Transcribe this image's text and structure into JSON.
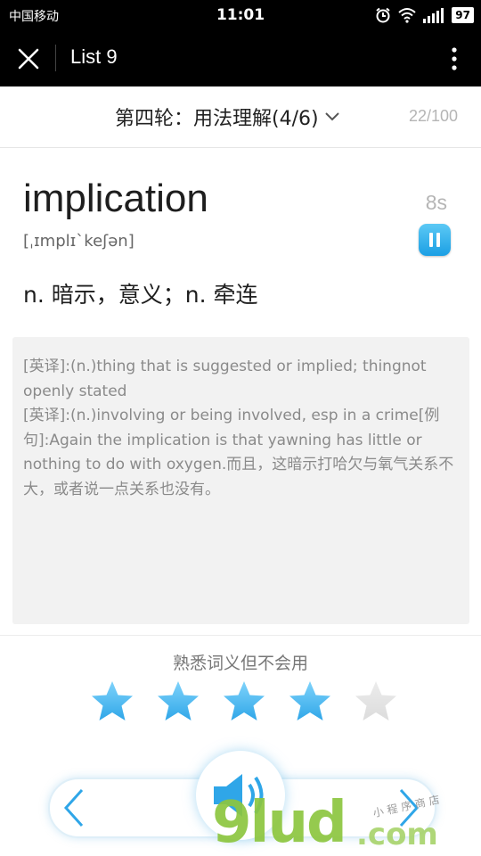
{
  "status_bar": {
    "carrier": "中国移动",
    "time": "11:01",
    "battery": "97",
    "icons": [
      "alarm-icon",
      "wifi-icon",
      "signal-icon",
      "battery-icon"
    ]
  },
  "app_bar": {
    "title": "List 9",
    "close_icon": "close-icon",
    "more_icon": "more-vert-icon"
  },
  "round": {
    "label": "第四轮：用法理解(4/6)",
    "progress": "22/100"
  },
  "word": {
    "headword": "implication",
    "phonetic": "[ˌɪmplɪˋkeʃən]",
    "timer": "8s",
    "meaning": "n. 暗示，意义；n. 牵连"
  },
  "definition": {
    "text": "[英译]:(n.)thing that is suggested or implied; thingnot openly stated\n[英译]:(n.)involving or being involved, esp in a crime[例句]:Again the implication is that yawning has little or nothing to do with oxygen.而且，这暗示打哈欠与氧气关系不大，或者说一点关系也没有。"
  },
  "rating": {
    "label": "熟悉词义但不会用",
    "value": 4,
    "max": 5
  },
  "colors": {
    "accent": "#1b9fe4",
    "star_on": "#2fa6e8",
    "star_off": "#dcdcdc"
  },
  "watermark": {
    "main": "9lud",
    "domain": ".com",
    "sub": "小程序商店"
  }
}
